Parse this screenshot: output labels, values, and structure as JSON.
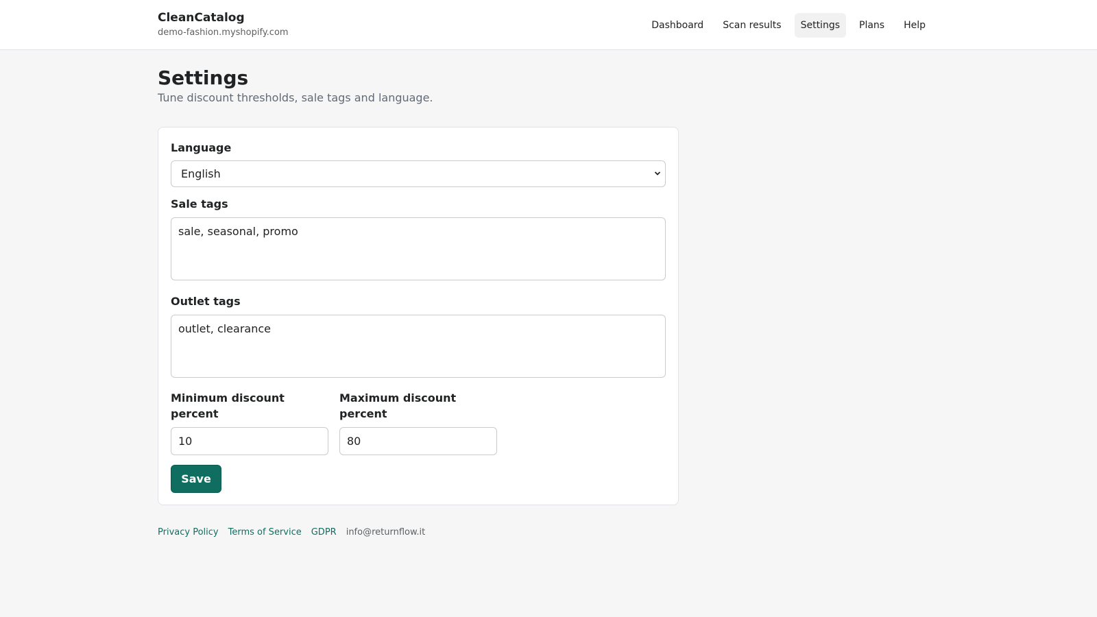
{
  "header": {
    "brand_name": "CleanCatalog",
    "shop_domain": "demo-fashion.myshopify.com",
    "nav": [
      {
        "label": "Dashboard",
        "active": false
      },
      {
        "label": "Scan results",
        "active": false
      },
      {
        "label": "Settings",
        "active": true
      },
      {
        "label": "Plans",
        "active": false
      },
      {
        "label": "Help",
        "active": false
      }
    ]
  },
  "page": {
    "title": "Settings",
    "subtitle": "Tune discount thresholds, sale tags and language."
  },
  "form": {
    "language": {
      "label": "Language",
      "value": "English"
    },
    "sale_tags": {
      "label": "Sale tags",
      "value": "sale, seasonal, promo"
    },
    "outlet_tags": {
      "label": "Outlet tags",
      "value": "outlet, clearance"
    },
    "min_discount": {
      "label_line1": "Minimum discount",
      "label_line2": "percent",
      "value": "10"
    },
    "max_discount": {
      "label_line1": "Maximum discount",
      "label_line2": "percent",
      "value": "80"
    },
    "save_label": "Save"
  },
  "footer": {
    "privacy": "Privacy Policy",
    "terms": "Terms of Service",
    "gdpr": "GDPR",
    "email": "info@returnflow.it"
  },
  "colors": {
    "accent": "#0f6e5f",
    "background": "#f6f6f7"
  }
}
